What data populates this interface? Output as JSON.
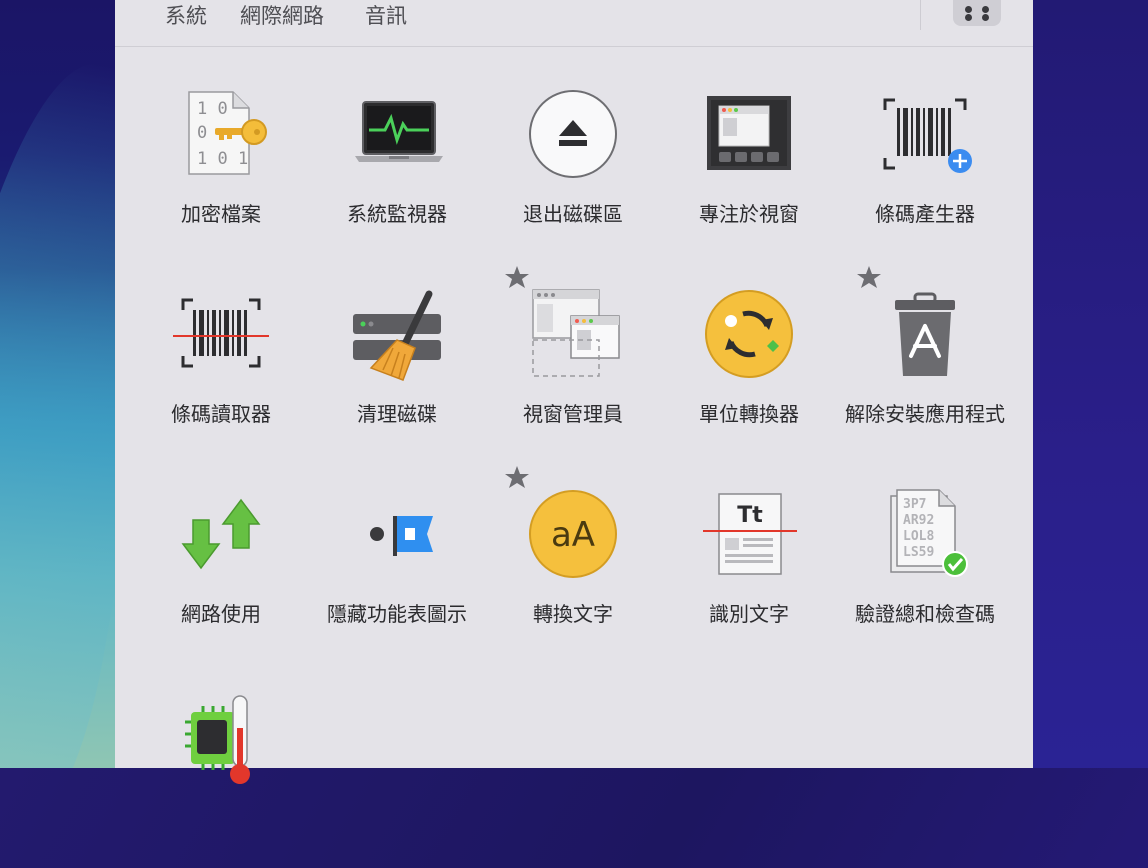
{
  "tabs": [
    "系統",
    "網際網路",
    "音訊"
  ],
  "apps": [
    {
      "label": "加密檔案",
      "icon": "encrypt-file-key-icon",
      "starred": false
    },
    {
      "label": "系統監視器",
      "icon": "system-monitor-icon",
      "starred": false
    },
    {
      "label": "退出磁碟區",
      "icon": "eject-icon",
      "starred": false
    },
    {
      "label": "專注於視窗",
      "icon": "focus-window-icon",
      "starred": false
    },
    {
      "label": "條碼產生器",
      "icon": "barcode-generator-icon",
      "starred": false
    },
    {
      "label": "條碼讀取器",
      "icon": "barcode-reader-icon",
      "starred": false
    },
    {
      "label": "清理磁碟",
      "icon": "disk-cleaner-broom-icon",
      "starred": false
    },
    {
      "label": "視窗管理員",
      "icon": "window-manager-icon",
      "starred": true
    },
    {
      "label": "單位轉換器",
      "icon": "unit-converter-icon",
      "starred": false
    },
    {
      "label": "解除安裝應用程式",
      "icon": "app-uninstaller-trash-icon",
      "starred": true
    },
    {
      "label": "網路使用",
      "icon": "network-usage-arrows-icon",
      "starred": false
    },
    {
      "label": "隱藏功能表圖示",
      "icon": "hide-menu-bar-icon",
      "starred": false
    },
    {
      "label": "轉換文字",
      "icon": "convert-text-case-icon",
      "starred": true
    },
    {
      "label": "識別文字",
      "icon": "recognize-text-ocr-icon",
      "starred": false
    },
    {
      "label": "驗證總和檢查碼",
      "icon": "checksum-verify-icon",
      "starred": false
    },
    {
      "label": "",
      "icon": "cpu-temperature-icon",
      "starred": false
    }
  ],
  "colors": {
    "panel_bg": "#e4e3e8",
    "accent_blue": "#3b8cf0",
    "accent_yellow": "#f3c33b",
    "accent_green": "#5cc03a",
    "star_gray": "#6d6d72"
  }
}
